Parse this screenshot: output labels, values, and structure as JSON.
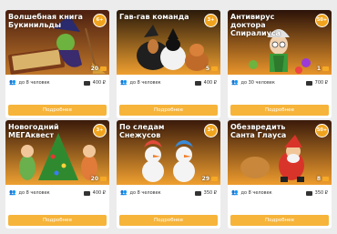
{
  "cards": [
    {
      "title": "Волшебная книга Букинильды",
      "age": "6+",
      "count": "20",
      "people": "до 8 человек",
      "price": "400 ₽",
      "more": "Подробнее"
    },
    {
      "title": "Гав-гав команда",
      "age": "3+",
      "count": "5",
      "people": "до 8 человек",
      "price": "400 ₽",
      "more": "Подробнее"
    },
    {
      "title": "Антивирус доктора Спиралиуса",
      "age": "50+",
      "count": "1",
      "people": "до 30 человек",
      "price": "700 ₽",
      "more": "Подробнее"
    },
    {
      "title": "Новогодний МЕГАквест",
      "age": "3+",
      "count": "20",
      "people": "до 8 человек",
      "price": "400 ₽",
      "more": "Подробнее"
    },
    {
      "title": "По следам Снежусов",
      "age": "3+",
      "count": "29",
      "people": "до 8 человек",
      "price": "350 ₽",
      "more": "Подробнее"
    },
    {
      "title": "Обезвредить Санта Глауса",
      "age": "50+",
      "count": "8",
      "people": "до 8 человек",
      "price": "350 ₽",
      "more": "Подробнее"
    }
  ],
  "colors": {
    "accent": "#f6b43a",
    "badge": "#f0a41e"
  }
}
